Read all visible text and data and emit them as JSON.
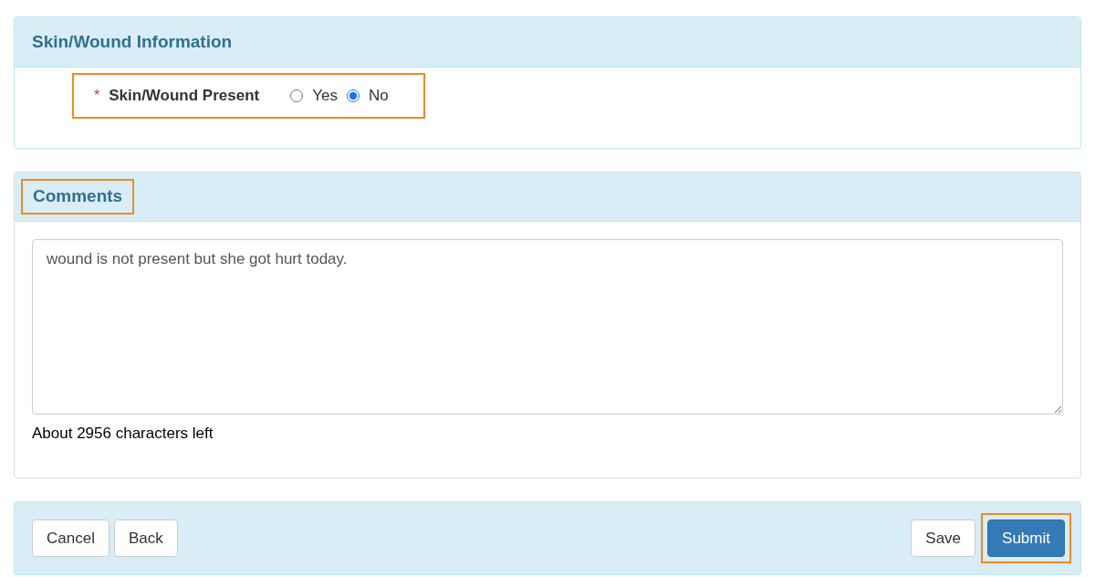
{
  "skin_panel": {
    "title": "Skin/Wound Information",
    "field": {
      "label": "Skin/Wound Present",
      "required_mark": "*",
      "required": true,
      "highlighted": true,
      "options": [
        {
          "label": "Yes",
          "selected": false
        },
        {
          "label": "No",
          "selected": true
        }
      ]
    }
  },
  "comments_panel": {
    "title": "Comments",
    "title_highlighted": true,
    "value": "wound is not present but she got hurt today.",
    "counter": "About 2956 characters left"
  },
  "footer": {
    "left_buttons": [
      {
        "label": "Cancel",
        "kind": "default",
        "highlighted": false
      },
      {
        "label": "Back",
        "kind": "default",
        "highlighted": false
      }
    ],
    "right_buttons": [
      {
        "label": "Save",
        "kind": "default",
        "highlighted": false
      },
      {
        "label": "Submit",
        "kind": "primary",
        "highlighted": true
      }
    ]
  }
}
